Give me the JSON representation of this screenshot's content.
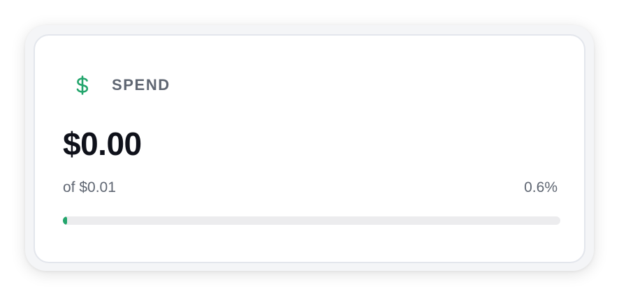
{
  "card": {
    "icon": "dollar-icon",
    "title": "SPEND",
    "amount": "$0.00",
    "limit_text": "of $0.01",
    "percent_text": "0.6%",
    "progress_fraction": 0.006
  },
  "colors": {
    "accent": "#23a56c",
    "text_primary": "#0f111a",
    "text_secondary": "#5f6672",
    "track": "#ececee"
  }
}
